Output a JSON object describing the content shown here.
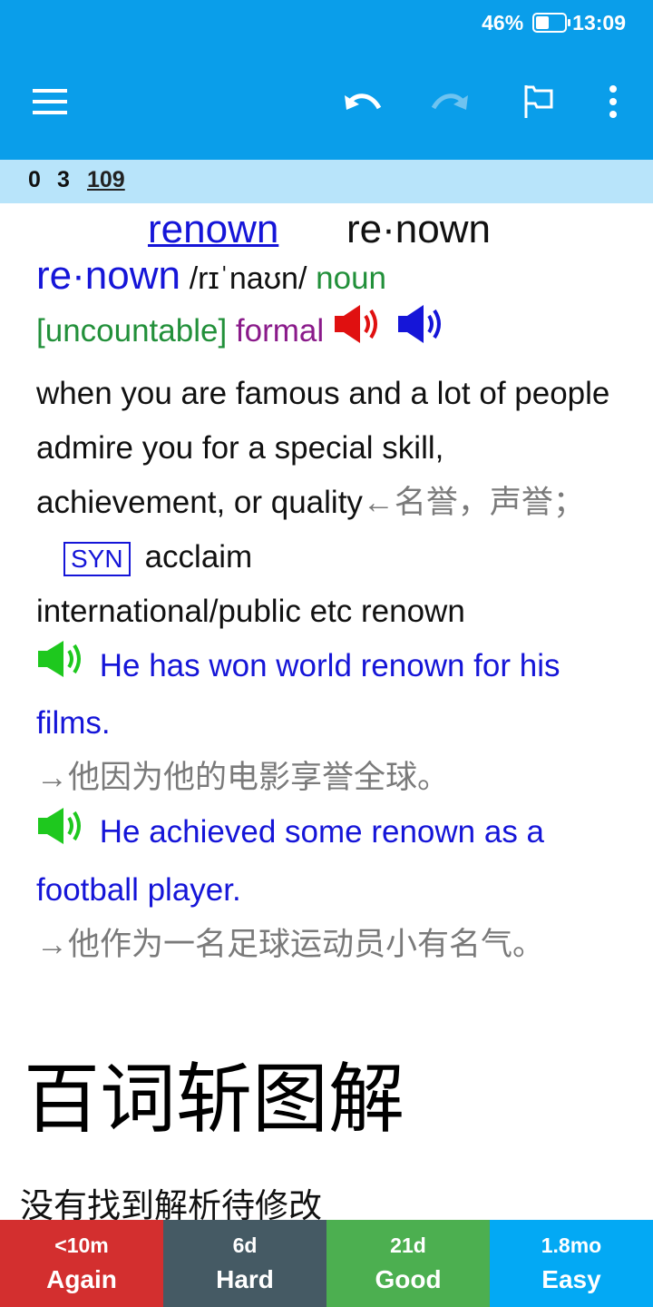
{
  "status": {
    "battery": "46%",
    "time": "13:09"
  },
  "toolbar": {
    "menu_icon": "hamburger-menu-icon",
    "undo_icon": "undo-icon",
    "redo_icon": "redo-icon",
    "flag_icon": "flag-icon",
    "more_icon": "more-vertical-icon"
  },
  "counts": {
    "new": "0",
    "learning": "3",
    "review": "109"
  },
  "card": {
    "word_link": "renown",
    "word_syllables": "re·nown",
    "headword": "re·nown",
    "pronunciation": "/rɪˈnaʊn/",
    "pos": "noun",
    "grammar": "[uncountable]",
    "register": "formal",
    "definition": "when you are famous and a lot of people admire you for a special skill, achievement, or quality",
    "definition_cn": "←名誉，声誉；",
    "syn_label": "SYN",
    "synonym": "acclaim",
    "collocation": "international/public etc renown",
    "examples": [
      {
        "en": "He has won world renown for his films.",
        "cn": "→他因为他的电影享誉全球。"
      },
      {
        "en": "He achieved some renown as a football player.",
        "cn": "→他作为一名足球运动员小有名气。"
      }
    ],
    "section_title": "百词斩图解",
    "section_note": "没有找到解析待修改"
  },
  "answer_buttons": [
    {
      "interval": "<10m",
      "label": "Again",
      "color": "#d32f2f"
    },
    {
      "interval": "6d",
      "label": "Hard",
      "color": "#455a64"
    },
    {
      "interval": "21d",
      "label": "Good",
      "color": "#4caf50"
    },
    {
      "interval": "1.8mo",
      "label": "Easy",
      "color": "#03a9f4"
    }
  ],
  "colors": {
    "toolbar": "#0a9eea",
    "counts_bar": "#b8e4fa",
    "link_blue": "#1515d8",
    "gram_green": "#22903a",
    "register_purple": "#8a1a8a"
  }
}
